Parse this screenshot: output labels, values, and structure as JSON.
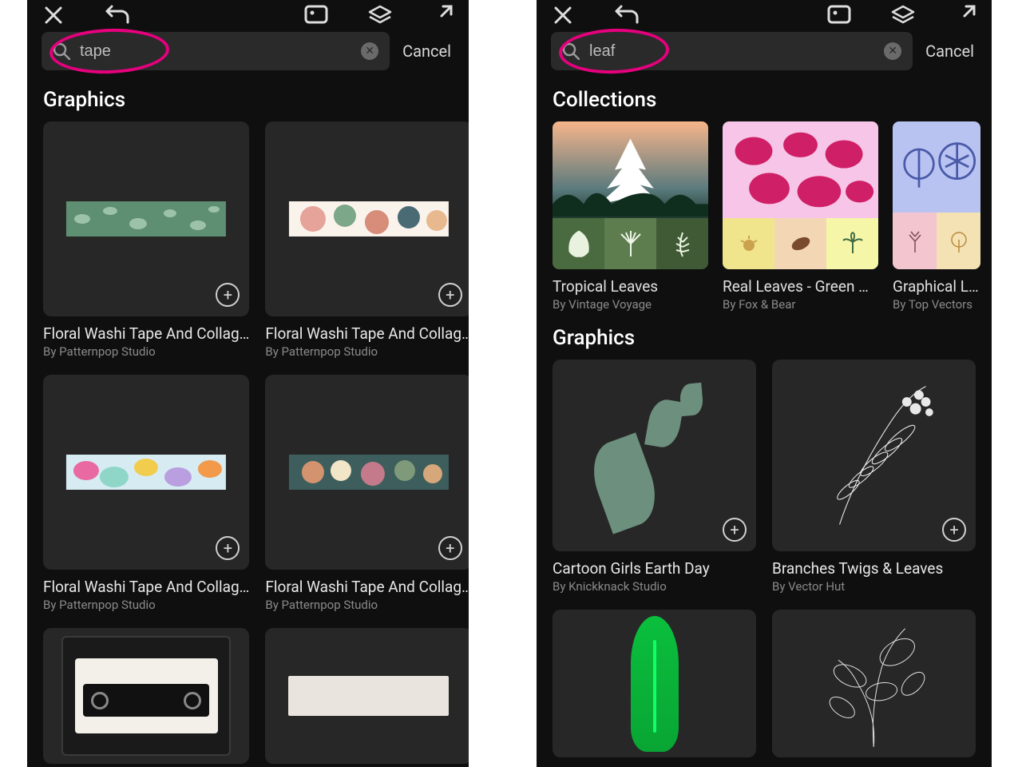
{
  "left": {
    "search": {
      "value": "tape",
      "cancel": "Cancel"
    },
    "graphics_label": "Graphics",
    "cards": [
      {
        "title": "Floral Washi Tape And Collag…",
        "author": "By Patternpop Studio"
      },
      {
        "title": "Floral Washi Tape And Collag…",
        "author": "By Patternpop Studio"
      },
      {
        "title": "Floral Washi Tape And Collag…",
        "author": "By Patternpop Studio"
      },
      {
        "title": "Floral Washi Tape And Collag…",
        "author": "By Patternpop Studio"
      }
    ]
  },
  "right": {
    "search": {
      "value": "leaf",
      "cancel": "Cancel"
    },
    "collections_label": "Collections",
    "graphics_label": "Graphics",
    "collections": [
      {
        "title": "Tropical Leaves",
        "author": "By Vintage Voyage"
      },
      {
        "title": "Real Leaves - Green Cu…",
        "author": "By Fox & Bear"
      },
      {
        "title": "Graphical Lea",
        "author": "By Top Vectors"
      }
    ],
    "cards": [
      {
        "title": "Cartoon Girls Earth Day",
        "author": "By Knickknack Studio"
      },
      {
        "title": "Branches Twigs & Leaves",
        "author": "By Vector Hut"
      }
    ]
  }
}
